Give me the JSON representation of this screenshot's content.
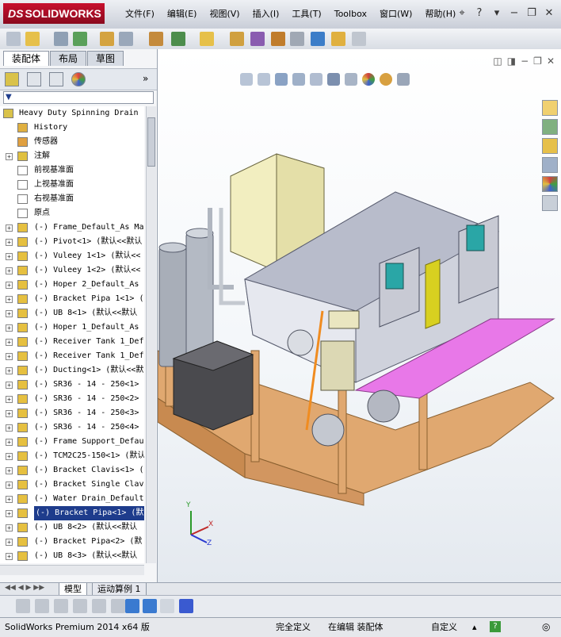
{
  "app": {
    "brand_prefix": "DS",
    "brand_name": "SOLIDWORKS"
  },
  "menu": [
    "文件(F)",
    "编辑(E)",
    "视图(V)",
    "插入(I)",
    "工具(T)",
    "Toolbox",
    "窗口(W)",
    "帮助(H)"
  ],
  "window_controls": {
    "help": "?",
    "minimize": "−",
    "restore": "❐",
    "close": "✕"
  },
  "panel_tabs": [
    "装配体",
    "布局",
    "草图"
  ],
  "filter_label": "▼",
  "tree": [
    {
      "label": "Heavy Duty Spinning Drain (",
      "icon": "assembly-icon",
      "expandable": false
    },
    {
      "label": "History",
      "icon": "history-icon",
      "expandable": false
    },
    {
      "label": "传感器",
      "icon": "sensor-icon",
      "expandable": false
    },
    {
      "label": "注解",
      "icon": "annotation-icon",
      "expandable": true
    },
    {
      "label": "前视基准面",
      "icon": "plane-icon",
      "expandable": false
    },
    {
      "label": "上视基准面",
      "icon": "plane-icon",
      "expandable": false
    },
    {
      "label": "右视基准面",
      "icon": "plane-icon",
      "expandable": false
    },
    {
      "label": "原点",
      "icon": "origin-icon",
      "expandable": false
    },
    {
      "label": "(-) Frame_Default_As Ma",
      "icon": "part-icon",
      "expandable": true
    },
    {
      "label": "(-) Pivot<1> (默认<<默认",
      "icon": "part-icon",
      "expandable": true
    },
    {
      "label": "(-) Vuleey 1<1> (默认<<",
      "icon": "part-icon",
      "expandable": true
    },
    {
      "label": "(-) Vuleey 1<2> (默认<<",
      "icon": "part-icon",
      "expandable": true
    },
    {
      "label": "(-) Hoper 2_Default_As",
      "icon": "part-icon",
      "expandable": true
    },
    {
      "label": "(-) Bracket Pipa 1<1> (",
      "icon": "part-icon",
      "expandable": true
    },
    {
      "label": "(-) UB 8<1> (默认<<默认",
      "icon": "part-icon",
      "expandable": true
    },
    {
      "label": "(-) Hoper 1_Default_As",
      "icon": "part-icon",
      "expandable": true
    },
    {
      "label": "(-) Receiver Tank 1_Def",
      "icon": "part-icon",
      "expandable": true
    },
    {
      "label": "(-) Receiver Tank 1_Def",
      "icon": "part-icon",
      "expandable": true
    },
    {
      "label": "(-) Ducting<1> (默认<<默",
      "icon": "part-icon",
      "expandable": true
    },
    {
      "label": "(-) SR36 - 14 - 250<1>",
      "icon": "part-icon",
      "expandable": true
    },
    {
      "label": "(-) SR36 - 14 - 250<2>",
      "icon": "part-icon",
      "expandable": true
    },
    {
      "label": "(-) SR36 - 14 - 250<3>",
      "icon": "part-icon",
      "expandable": true
    },
    {
      "label": "(-) SR36 - 14 - 250<4>",
      "icon": "part-icon",
      "expandable": true
    },
    {
      "label": "(-) Frame Support_Defau",
      "icon": "part-icon",
      "expandable": true
    },
    {
      "label": "(-) TCM2C25-150<1> (默认",
      "icon": "part-icon",
      "expandable": true
    },
    {
      "label": "(-) Bracket Clavis<1> (",
      "icon": "part-icon",
      "expandable": true
    },
    {
      "label": "(-) Bracket Single Clav",
      "icon": "part-icon",
      "expandable": true
    },
    {
      "label": "(-) Water Drain_Default",
      "icon": "part-icon",
      "expandable": true
    },
    {
      "label": "(-) Bracket Pipa<1> (默",
      "icon": "part-icon",
      "expandable": true,
      "selected": true
    },
    {
      "label": "(-) UB 8<2> (默认<<默认",
      "icon": "part-icon",
      "expandable": true
    },
    {
      "label": "(-) Bracket Pipa<2> (默",
      "icon": "part-icon",
      "expandable": true
    },
    {
      "label": "(-) UB 8<3> (默认<<默认",
      "icon": "part-icon",
      "expandable": true
    }
  ],
  "bottom_tabs": [
    "模型",
    "运动算例 1"
  ],
  "status": {
    "product": "SolidWorks Premium 2014 x64 版",
    "definition": "完全定义",
    "mode": "在编辑 装配体",
    "units": "自定义"
  },
  "triad": {
    "x": "X",
    "y": "Y",
    "z": "Z"
  },
  "colors": {
    "accent": "#1e3c8c",
    "brand": "#c8102e",
    "frame_wood": "#e0a870",
    "magenta_plate": "#e878e8",
    "yellow_strip": "#d8d020"
  }
}
